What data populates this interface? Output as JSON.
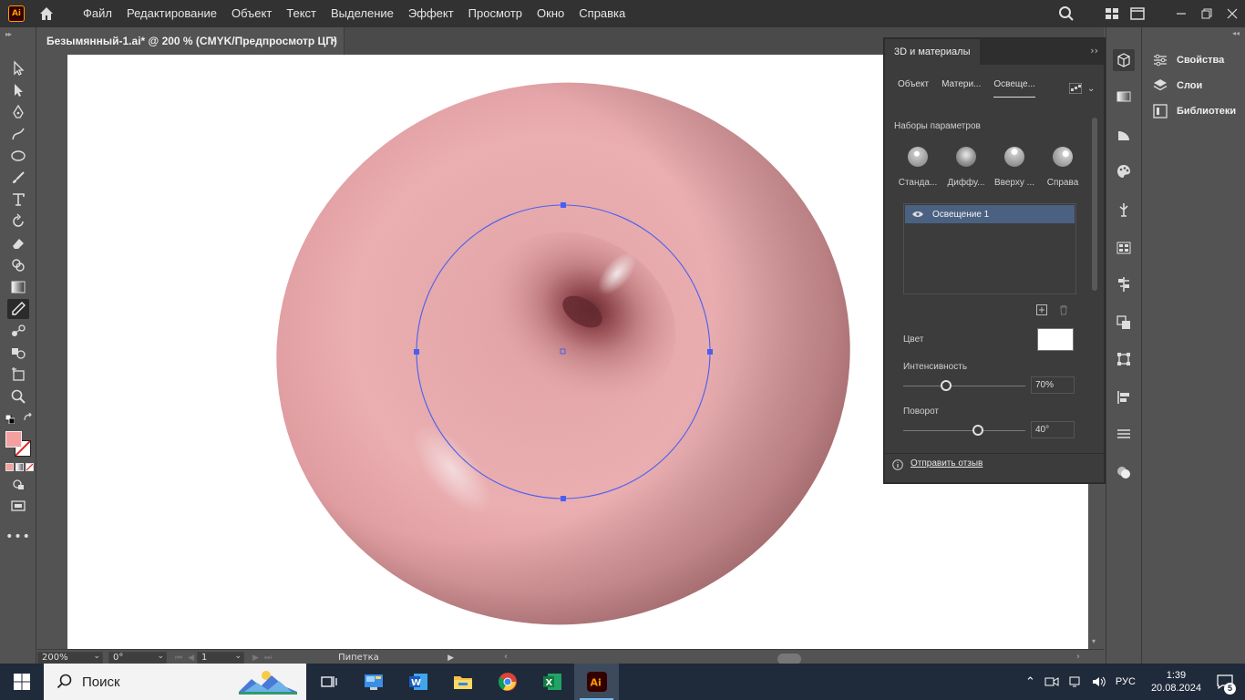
{
  "app": {
    "logo_text": "Ai",
    "menu": [
      "Файл",
      "Редактирование",
      "Объект",
      "Текст",
      "Выделение",
      "Эффект",
      "Просмотр",
      "Окно",
      "Справка"
    ]
  },
  "document": {
    "tab_title": "Безымянный-1.ai* @ 200 % (CMYK/Предпросмотр ЦП)",
    "close": "×"
  },
  "statusbar": {
    "zoom": "200%",
    "rotation": "0°",
    "artboard": "1",
    "tool_name": "Пипетка"
  },
  "panel_3d": {
    "title": "3D и материалы",
    "tabs": [
      "Объект",
      "Матери...",
      "Освеще..."
    ],
    "active_tab": 2,
    "presets_label": "Наборы параметров",
    "presets": [
      "Станда...",
      "Диффу...",
      "Вверху ...",
      "Справа"
    ],
    "lights": [
      "Освещение 1"
    ],
    "color_label": "Цвет",
    "color_value": "#ffffff",
    "intensity_label": "Интенсивность",
    "intensity_value": "70%",
    "intensity_fraction": 0.35,
    "rotation_label": "Поворот",
    "rotation_value": "40°",
    "rotation_fraction": 0.61,
    "feedback": "Отправить отзыв"
  },
  "side_panels": [
    "Свойства",
    "Слои",
    "Библиотеки"
  ],
  "taskbar": {
    "search_placeholder": "Поиск",
    "language": "РУС",
    "time": "1:39",
    "date": "20.08.2024",
    "notifications": "5"
  },
  "colors": {
    "accent_selection": "#4a5ff0",
    "fill_swatch": "#f4a0a0",
    "donut": "#e8a4a6"
  }
}
